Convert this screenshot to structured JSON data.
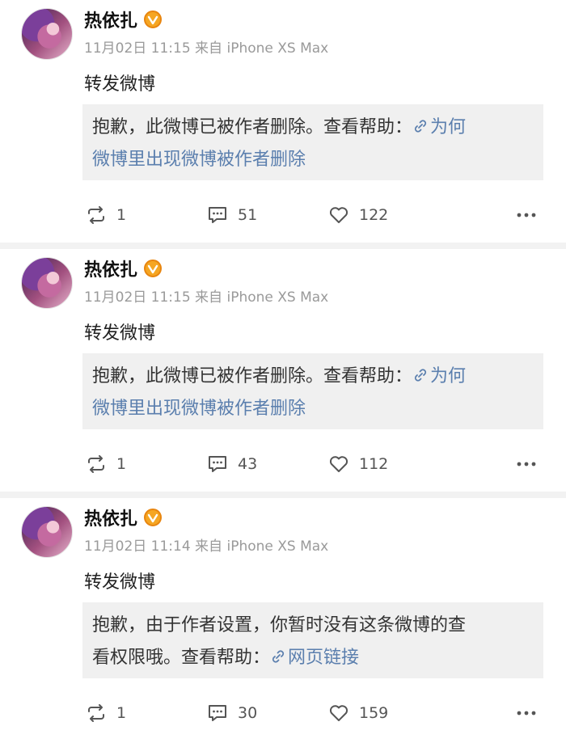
{
  "posts": [
    {
      "username": "热依扎",
      "meta": "11月02日 11:15 来自 iPhone XS Max",
      "text": "转发微博",
      "quote_line1": "抱歉，此微博已被作者删除。查看帮助：",
      "quote_link1": "为何",
      "quote_link2": "微博里出现微博被作者删除",
      "reposts": "1",
      "comments": "51",
      "likes": "122"
    },
    {
      "username": "热依扎",
      "meta": "11月02日 11:15 来自 iPhone XS Max",
      "text": "转发微博",
      "quote_line1": "抱歉，此微博已被作者删除。查看帮助：",
      "quote_link1": "为何",
      "quote_link2": "微博里出现微博被作者删除",
      "reposts": "1",
      "comments": "43",
      "likes": "112"
    },
    {
      "username": "热依扎",
      "meta": "11月02日 11:14 来自 iPhone XS Max",
      "text": "转发微博",
      "quote_line1": "抱歉，由于作者设置，你暂时没有这条微博的查",
      "quote_line2": "看权限哦。查看帮助：",
      "quote_link": "网页链接",
      "reposts": "1",
      "comments": "30",
      "likes": "159"
    }
  ],
  "colors": {
    "link": "#5b7fae",
    "verified": "#f5a623",
    "meta": "#9a9a9a",
    "quote_bg": "#f0f0f0"
  },
  "icons": {
    "repost": "repost-icon",
    "comment": "comment-icon",
    "like": "heart-icon",
    "more": "more-dots-icon",
    "link": "link-icon",
    "verified": "verified-badge-icon"
  }
}
